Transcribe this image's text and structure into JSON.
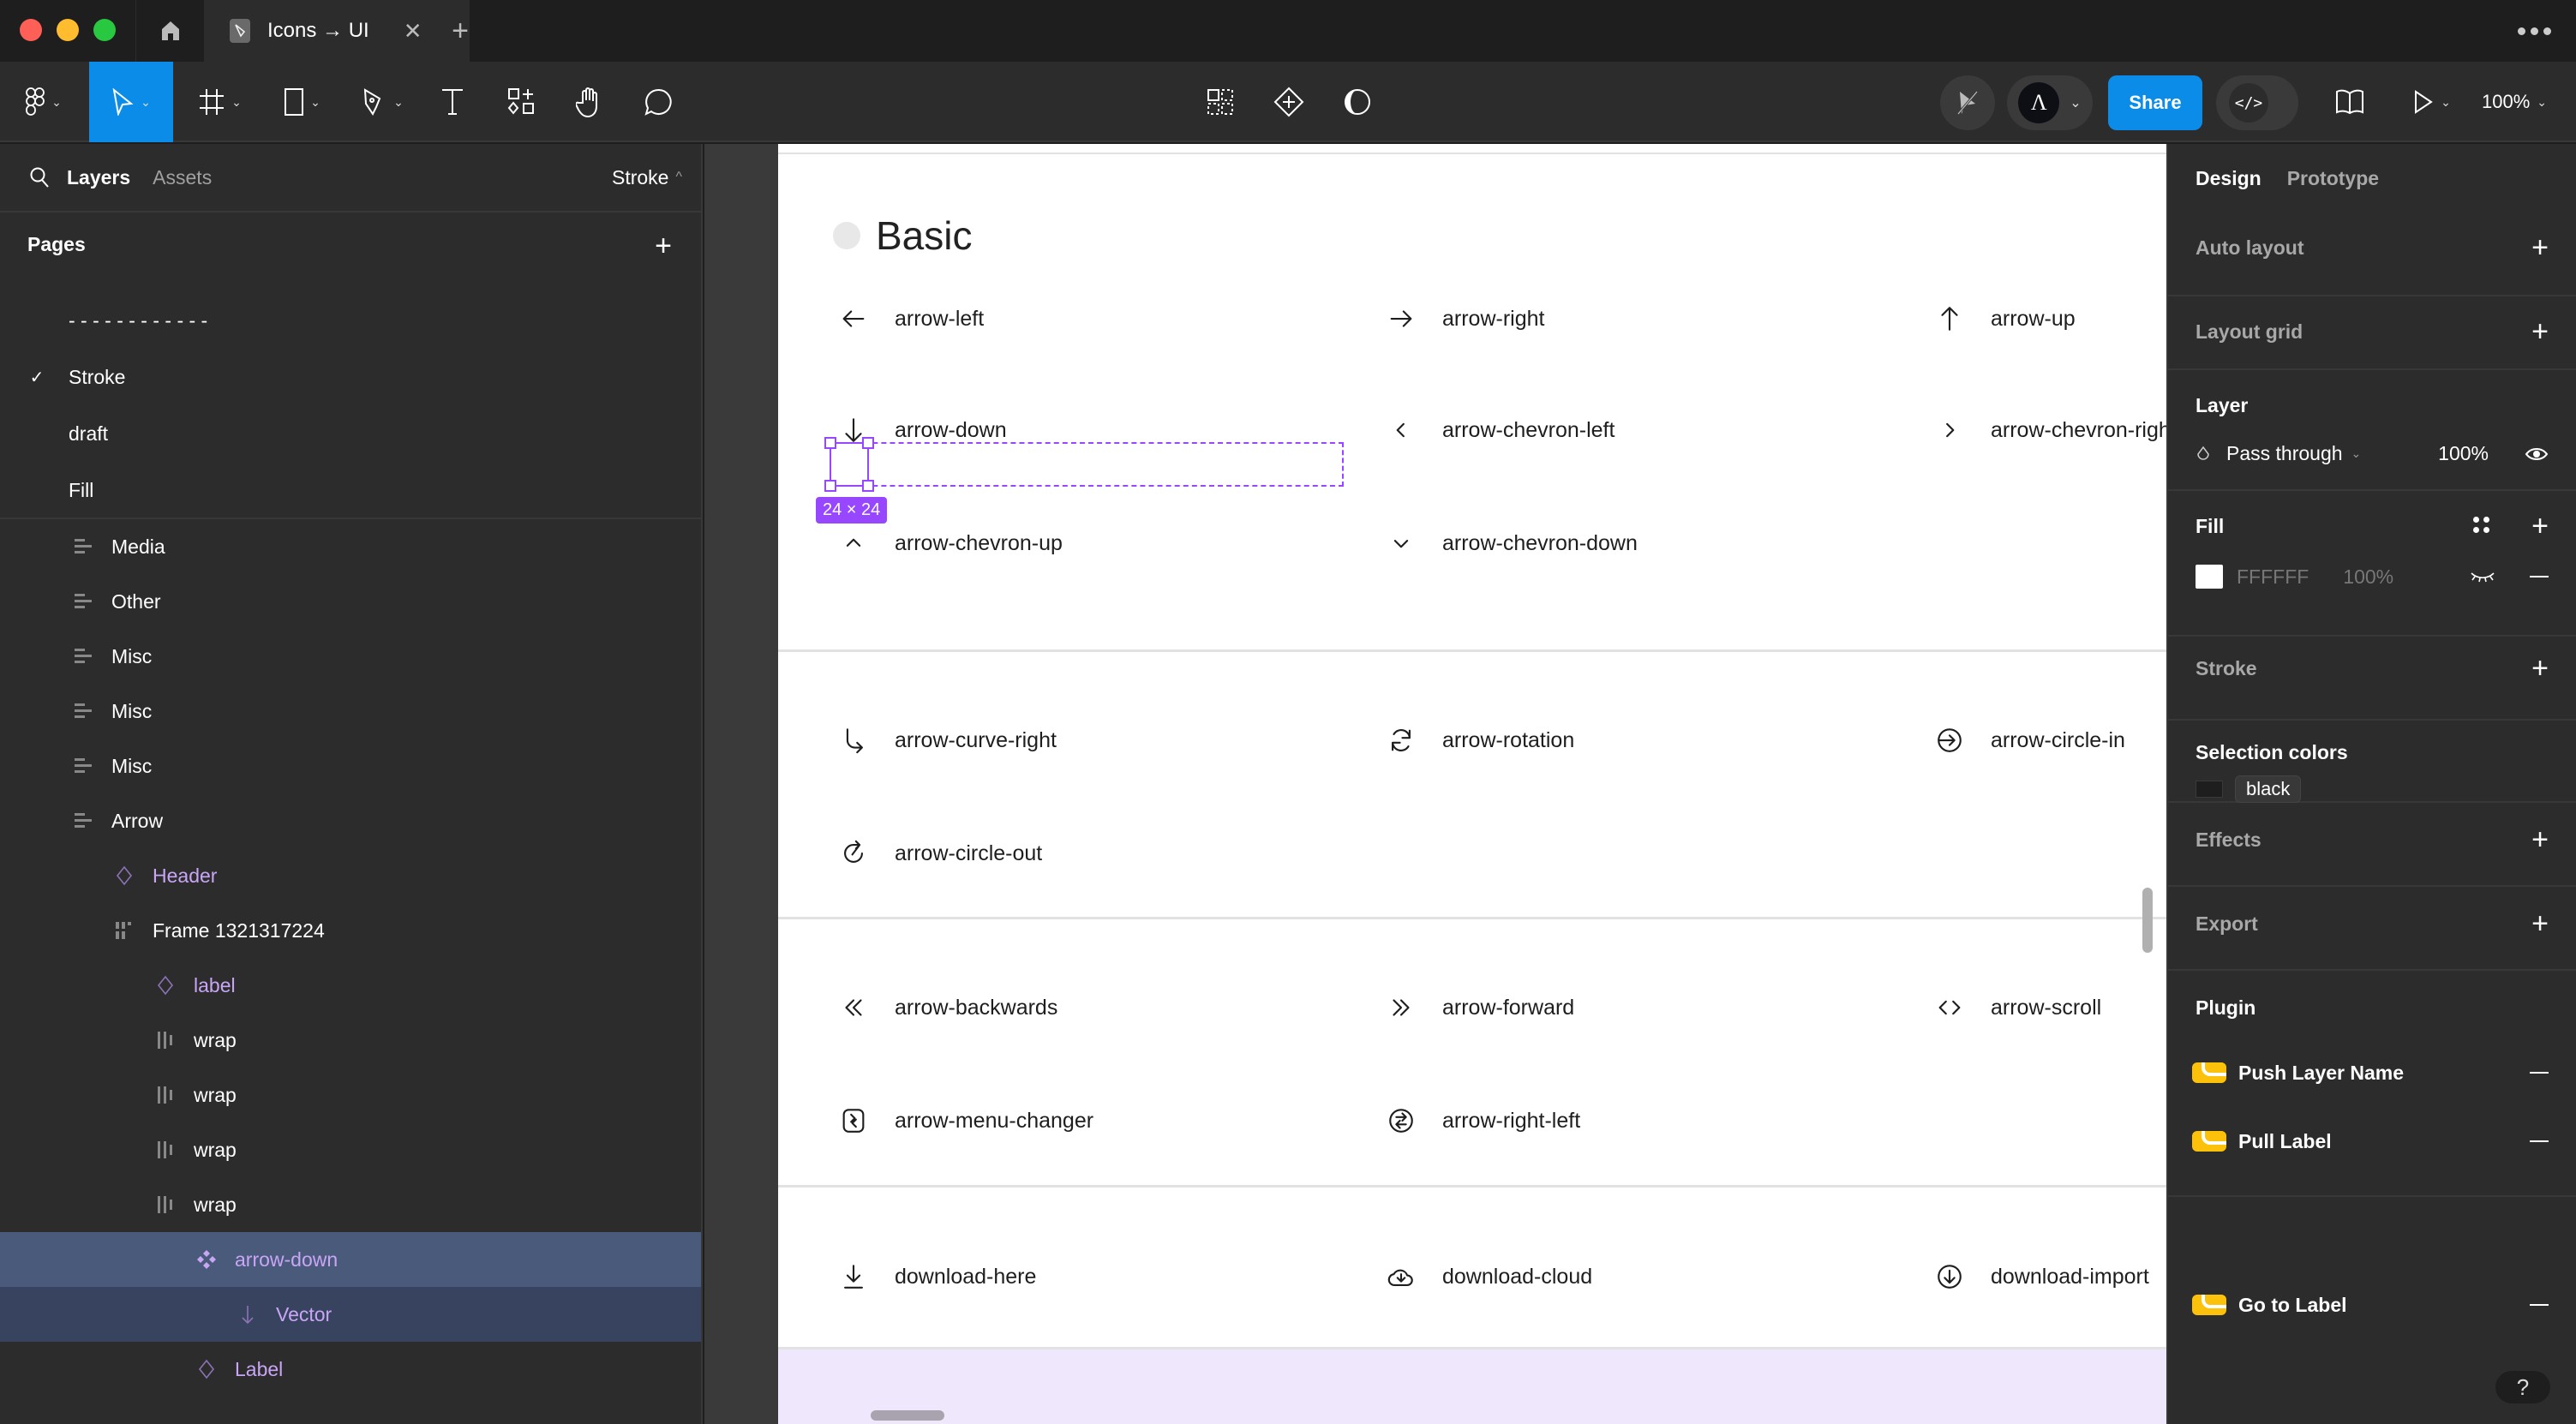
{
  "window": {
    "tab_title": "Icons → UI",
    "tab_icon": "pen-tool-file-icon",
    "new_tab": "+",
    "close": "✕"
  },
  "toolbar": {
    "tools": [
      {
        "name": "main-menu",
        "icon": "figma-logo-icon",
        "has_menu": true
      },
      {
        "name": "move",
        "icon": "cursor-arrow-icon",
        "has_menu": true,
        "active": true
      },
      {
        "name": "frame",
        "icon": "frame-hash-icon",
        "has_menu": true
      },
      {
        "name": "shape",
        "icon": "rectangle-icon",
        "has_menu": true
      },
      {
        "name": "pen",
        "icon": "pen-icon",
        "has_menu": true
      },
      {
        "name": "text",
        "icon": "text-icon",
        "has_menu": false
      },
      {
        "name": "resources",
        "icon": "resources-icon",
        "has_menu": false
      },
      {
        "name": "hand",
        "icon": "hand-icon",
        "has_menu": false
      },
      {
        "name": "comment",
        "icon": "comment-icon",
        "has_menu": false
      }
    ],
    "center_tools": [
      "components-grid-icon",
      "create-component-icon",
      "contrast-icon"
    ],
    "share_label": "Share",
    "zoom_label": "100%"
  },
  "left_panel": {
    "tabs": {
      "layers": "Layers",
      "assets": "Assets"
    },
    "current_page": "Stroke",
    "pages_title": "Pages",
    "pages": [
      {
        "name": "- - - - - - - - - - - -",
        "current": false
      },
      {
        "name": "Stroke",
        "current": true
      },
      {
        "name": "draft",
        "current": false
      },
      {
        "name": "Fill",
        "current": false
      }
    ],
    "layers": [
      {
        "name": "Media",
        "type": "section",
        "indent": 0
      },
      {
        "name": "Other",
        "type": "section",
        "indent": 0
      },
      {
        "name": "Misc",
        "type": "section",
        "indent": 0
      },
      {
        "name": "Misc",
        "type": "section",
        "indent": 0
      },
      {
        "name": "Misc",
        "type": "section",
        "indent": 0
      },
      {
        "name": "Arrow",
        "type": "section",
        "indent": 0
      },
      {
        "name": "Header",
        "type": "instance",
        "indent": 1
      },
      {
        "name": "Frame 1321317224",
        "type": "frame",
        "indent": 1
      },
      {
        "name": "label",
        "type": "instance",
        "indent": 2
      },
      {
        "name": "wrap",
        "type": "autolayout",
        "indent": 2
      },
      {
        "name": "wrap",
        "type": "autolayout",
        "indent": 2
      },
      {
        "name": "wrap",
        "type": "autolayout",
        "indent": 2
      },
      {
        "name": "wrap",
        "type": "autolayout",
        "indent": 2
      },
      {
        "name": "arrow-down",
        "type": "component",
        "indent": 3,
        "selected": true
      },
      {
        "name": "Vector",
        "type": "vector",
        "indent": 4,
        "child_selected": true
      },
      {
        "name": "Label",
        "type": "instance",
        "indent": 3
      }
    ]
  },
  "canvas": {
    "section_title": "Basic",
    "selection_size": "24 × 24",
    "groups": [
      [
        {
          "label": "arrow-left",
          "icon": "arrow-left-icon"
        },
        {
          "label": "arrow-right",
          "icon": "arrow-right-icon"
        },
        {
          "label": "arrow-up",
          "icon": "arrow-up-icon"
        },
        {
          "label": "arrow-down",
          "icon": "arrow-down-icon"
        },
        {
          "label": "arrow-chevron-left",
          "icon": "chevron-left-icon"
        },
        {
          "label": "arrow-chevron-right",
          "icon": "chevron-right-icon"
        },
        {
          "label": "arrow-chevron-up",
          "icon": "chevron-up-icon"
        },
        {
          "label": "arrow-chevron-down",
          "icon": "chevron-down-icon"
        }
      ],
      [
        {
          "label": "arrow-curve-right",
          "icon": "arrow-curve-right-icon"
        },
        {
          "label": "arrow-rotation",
          "icon": "rotation-icon"
        },
        {
          "label": "arrow-circle-in",
          "icon": "arrow-circle-in-icon"
        },
        {
          "label": "arrow-circle-out",
          "icon": "arrow-circle-out-icon"
        }
      ],
      [
        {
          "label": "arrow-backwards",
          "icon": "double-chevron-left-icon"
        },
        {
          "label": "arrow-forward",
          "icon": "double-chevron-right-icon"
        },
        {
          "label": "arrow-scroll",
          "icon": "code-brackets-icon"
        },
        {
          "label": "arrow-menu-changer",
          "icon": "menu-changer-icon"
        },
        {
          "label": "arrow-right-left",
          "icon": "swap-circle-icon"
        }
      ],
      [
        {
          "label": "download-here",
          "icon": "download-here-icon"
        },
        {
          "label": "download-cloud",
          "icon": "cloud-download-icon"
        },
        {
          "label": "download-import",
          "icon": "download-circle-icon"
        }
      ]
    ]
  },
  "right_panel": {
    "tabs": {
      "design": "Design",
      "prototype": "Prototype"
    },
    "auto_layout": "Auto layout",
    "layout_grid": "Layout grid",
    "layer": {
      "title": "Layer",
      "blend_mode": "Pass through",
      "opacity": "100%"
    },
    "fill": {
      "title": "Fill",
      "hex": "FFFFFF",
      "opacity": "100%",
      "swatch_color": "#ffffff"
    },
    "stroke": "Stroke",
    "selection_colors": {
      "title": "Selection colors",
      "colors": [
        {
          "name": "black",
          "swatch": "#1e1e1e"
        }
      ]
    },
    "effects": "Effects",
    "export": "Export",
    "plugin": {
      "title": "Plugin",
      "items": [
        "Push Layer Name",
        "Pull Label",
        "Go to Label"
      ]
    },
    "help": "?"
  },
  "colors": {
    "accent": "#0c8ce9",
    "selection": "#9747ff",
    "component": "#c8a6f5"
  }
}
